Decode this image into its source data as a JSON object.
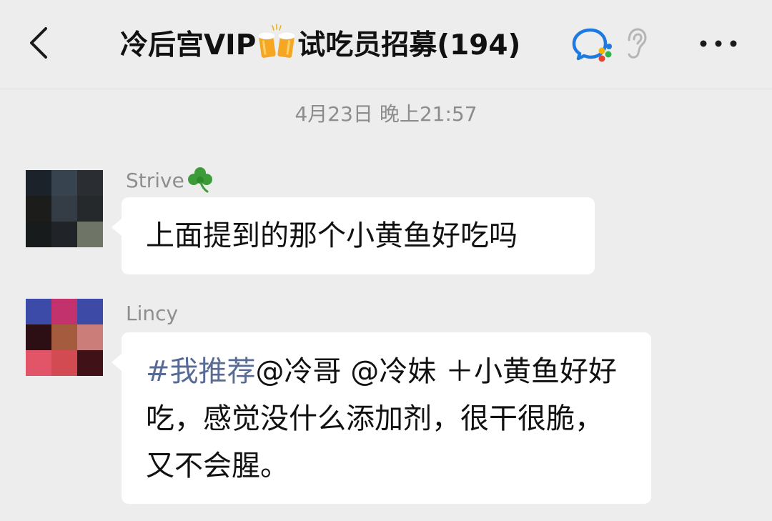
{
  "header": {
    "back_icon": "chevron-left-icon",
    "title_prefix": "冷后宫VIP",
    "title_emoji": "🍻",
    "title_suffix": "试吃员招募(194)",
    "chat_icon": "wecom-chat-icon",
    "ear_icon": "earpiece-icon",
    "more_icon": "more-dots-icon"
  },
  "timestamp": "4月23日 晚上21:57",
  "messages": [
    {
      "sender": "Strive",
      "sender_emoji": "☘️",
      "text": "上面提到的那个小黄鱼好吃吗",
      "avatar_colors": [
        "#1c2229",
        "#37434f",
        "#2a2e33",
        "#1c1d1b",
        "#343c46",
        "#26292c",
        "#171b1c",
        "#202328",
        "#6e7566"
      ]
    },
    {
      "sender": "Lincy",
      "hashtag": "#我推荐",
      "text_rest": "@冷哥  @冷妹 ＋小黄鱼好好吃，感觉没什么添加剂，很干很脆，又不会腥。",
      "avatar_colors": [
        "#3c4aa8",
        "#c2326d",
        "#3d4aa6",
        "#2b0f14",
        "#a55b3e",
        "#cb7e79",
        "#e25568",
        "#d24a52",
        "#401217"
      ]
    }
  ],
  "colors": {
    "background": "#ededed",
    "bubble": "#ffffff",
    "hashtag": "#576b95",
    "meta_text": "#8c8c8c"
  }
}
